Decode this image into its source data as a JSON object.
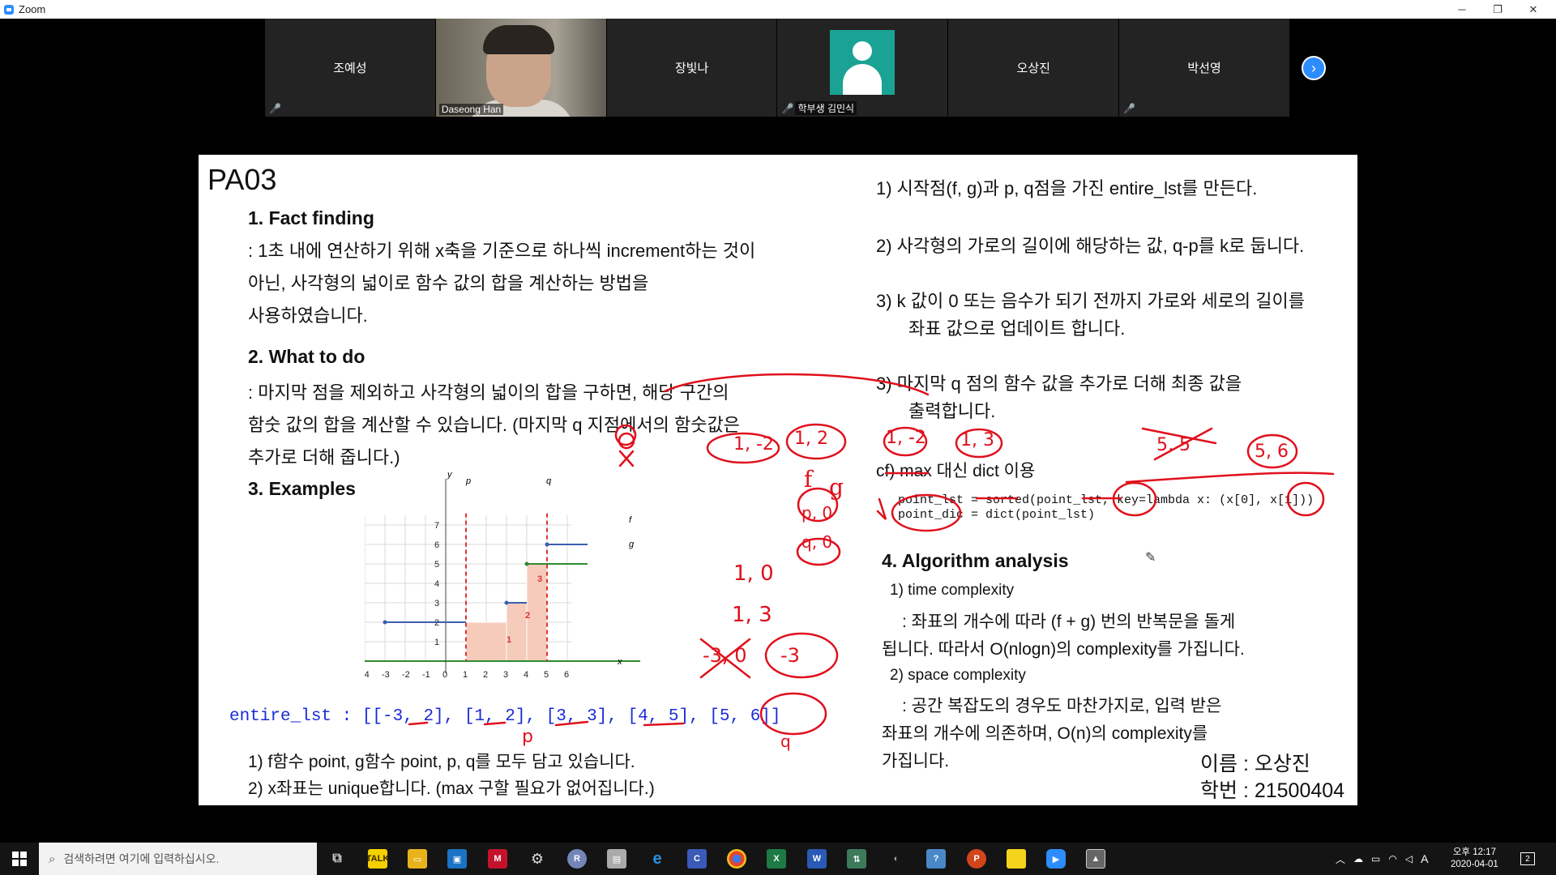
{
  "window": {
    "title": "Zoom",
    "minimize": "─",
    "maximize": "❐",
    "close": "✕"
  },
  "participants": [
    {
      "name": "조예성",
      "kind": "name-only",
      "muted": true
    },
    {
      "name": "Daseong Han",
      "kind": "video",
      "muted": false
    },
    {
      "name": "장빛나",
      "kind": "name-only",
      "muted": false
    },
    {
      "name": "학부생 김민식",
      "kind": "avatar",
      "muted": true
    },
    {
      "name": "오상진",
      "kind": "name-only",
      "muted": false
    },
    {
      "name": "박선영",
      "kind": "name-only",
      "muted": true
    }
  ],
  "slide": {
    "title": "PA03",
    "s1": {
      "head": "1.   Fact finding",
      "lines": [
        ": 1초 내에 연산하기 위해 x축을 기준으로 하나씩 increment하는 것이",
        "아닌, 사각형의 넓이로 함수 값의 합을 계산하는 방법을",
        "사용하였습니다."
      ]
    },
    "s2": {
      "head": "2.   What to do",
      "lines": [
        ": 마지막 점을 제외하고 사각형의 넓이의 합을 구하면, 해당 구간의",
        "함숫 값의 합을 계산할 수 있습니다. (마지막 q 지점에서의 함숫값은",
        "추가로 더해 줍니다.)"
      ]
    },
    "s3": {
      "head": "3.   Examples"
    },
    "entire": "entire_lst :  [[-3, 2], [1, 2], [3, 3], [4, 5], [5, 6]]",
    "notes": [
      "1)    f함수 point, g함수 point, p, q를 모두 담고 있습니다.",
      "2)    x좌표는 unique합니다. (max 구할 필요가 없어집니다.)"
    ],
    "steps": [
      [
        "1)    시작점(f, g)과 p, q점을 가진 entire_lst를 만든다."
      ],
      [
        "2)    사각형의 가로의 길이에 해당하는 값, q-p를 k로 둡니다."
      ],
      [
        "3)    k 값이 0 또는 음수가 되기 전까지 가로와 세로의 길이를",
        "좌표 값으로 업데이트 합니다."
      ],
      [
        "3)    마지막 q 점의 함수 값을 추가로 더해 최종 값을",
        "출력합니다."
      ]
    ],
    "cf": "cf) max 대신 dict 이용",
    "code1": "point_lst = sorted(point_lst, key=lambda x: (x[0], x[1]))",
    "code2": "point_dic = dict(point_lst)",
    "s4": {
      "head": "4.   Algorithm analysis",
      "time_head": "1) time complexity",
      "time_lines": [
        ": 좌표의 개수에 따라 (f + g) 번의 반복문을 돌게",
        "됩니다. 따라서 O(nlogn)의 complexity를 가집니다."
      ],
      "space_head": "2) space complexity",
      "space_lines": [
        ": 공간 복잡도의 경우도 마찬가지로, 입력 받은",
        "좌표의 개수에 의존하며, O(n)의 complexity를",
        "가집니다."
      ]
    },
    "name_line": "이름 : 오상진",
    "id_line": "학번 : 21500404"
  },
  "graph": {
    "x_ticks": [
      "-4",
      "-3",
      "-2",
      "-1",
      "0",
      "1",
      "2",
      "3",
      "4",
      "5",
      "6"
    ],
    "y_ticks": [
      "1",
      "2",
      "3",
      "4",
      "5",
      "6",
      "7"
    ],
    "x_label": "x",
    "y_label": "y",
    "p_label": "p",
    "q_label": "q",
    "f_label": "f",
    "g_label": "g",
    "rect_labels": [
      "1",
      "2",
      "3"
    ]
  },
  "ink": {
    "pairs": [
      "1, -2",
      "1, 2",
      "1, -2",
      "1, 3"
    ],
    "fg": [
      "f",
      "g"
    ],
    "p0": "p, 0",
    "q0": "q, 0",
    "p1": "1, 0",
    "p2": "1, 3",
    "x": "-3, 0",
    "c": "-3",
    "top": "5, 5",
    "top2": "5, 6",
    "p": "p",
    "q": "q"
  },
  "taskbar": {
    "search_placeholder": "검색하려면 여기에 입력하십시오.",
    "time": "오후 12:17",
    "date": "2020-04-01",
    "ime": "A",
    "notif": "2"
  }
}
